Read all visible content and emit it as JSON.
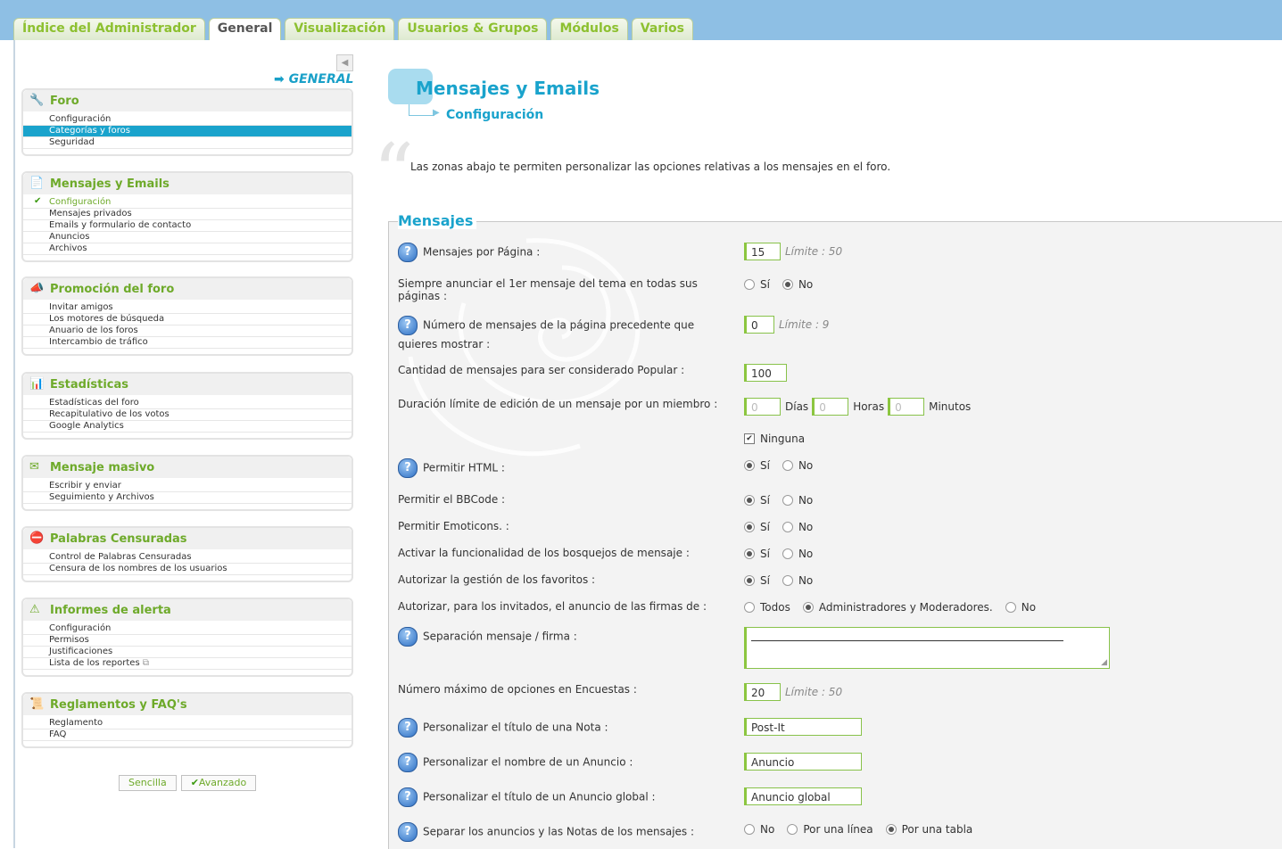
{
  "tabs": [
    "Índice del Administrador",
    "General",
    "Visualización",
    "Usuarios & Grupos",
    "Módulos",
    "Varios"
  ],
  "active_tab": "General",
  "breadcrumb": "➡ GENERAL",
  "sidebar": {
    "sections": [
      {
        "title": "Foro",
        "icon": "wrench-icon",
        "items": [
          "Configuración",
          "Categorías y foros",
          "Seguridad"
        ],
        "selected": 1
      },
      {
        "title": "Mensajes y Emails",
        "icon": "document-icon",
        "items": [
          "Configuración",
          "Mensajes privados",
          "Emails y formulario de contacto",
          "Anuncios",
          "Archivos"
        ],
        "current": 0
      },
      {
        "title": "Promoción del foro",
        "icon": "megaphone-icon",
        "items": [
          "Invitar amigos",
          "Los motores de búsqueda",
          "Anuario de los foros",
          "Intercambio de tráfico"
        ]
      },
      {
        "title": "Estadísticas",
        "icon": "chart-icon",
        "items": [
          "Estadísticas del foro",
          "Recapitulativo de los votos",
          "Google Analytics"
        ]
      },
      {
        "title": "Mensaje masivo",
        "icon": "mail-icon",
        "items": [
          "Escribir y enviar",
          "Seguimiento y Archivos"
        ]
      },
      {
        "title": "Palabras Censuradas",
        "icon": "forbidden-icon",
        "items": [
          "Control de Palabras Censuradas",
          "Censura de los nombres de los usuarios"
        ]
      },
      {
        "title": "Informes de alerta",
        "icon": "alert-icon",
        "items": [
          "Configuración",
          "Permisos",
          "Justificaciones",
          "Lista de los reportes"
        ]
      },
      {
        "title": "Reglamentos y FAQ's",
        "icon": "scroll-icon",
        "items": [
          "Reglamento",
          "FAQ"
        ]
      }
    ],
    "mode_simple": "Sencilla",
    "mode_advanced": "Avanzado"
  },
  "page": {
    "title": "Mensajes y Emails",
    "subtitle": "Configuración",
    "intro": "Las zonas abajo te permiten personalizar las opciones relativas a los mensajes en el foro.",
    "legend": "Mensajes"
  },
  "fields": {
    "posts_per_page": {
      "label": "Mensajes por Página :",
      "value": "15",
      "limit": "Límite : 50"
    },
    "announce_first": {
      "label": "Siempre anunciar el 1er mensaje del tema en todas sus páginas :",
      "yes": "Sí",
      "no": "No"
    },
    "prev_page_posts": {
      "label": "Número de mensajes de la página precedente que quieres mostrar :",
      "value": "0",
      "limit": "Límite : 9"
    },
    "popular_count": {
      "label": "Cantidad de mensajes para ser considerado Popular :",
      "value": "100"
    },
    "edit_limit": {
      "label": "Duración límite de edición de un mensaje por un miembro :",
      "days_ph": "0",
      "days": "Días",
      "hours_ph": "0",
      "hours": "Horas",
      "minutes_ph": "0",
      "minutes": "Minutos",
      "none": "Ninguna"
    },
    "allow_html": {
      "label": "Permitir HTML :",
      "yes": "Sí",
      "no": "No"
    },
    "allow_bbcode": {
      "label": "Permitir el BBCode :",
      "yes": "Sí",
      "no": "No"
    },
    "allow_emoticons": {
      "label": "Permitir Emoticons. :",
      "yes": "Sí",
      "no": "No"
    },
    "drafts": {
      "label": "Activar la funcionalidad de los bosquejos de mensaje :",
      "yes": "Sí",
      "no": "No"
    },
    "favorites": {
      "label": "Autorizar la gestión de los favoritos :",
      "yes": "Sí",
      "no": "No"
    },
    "guest_signatures": {
      "label": "Autorizar, para los invitados, el anuncio de las firmas de :",
      "opt1": "Todos",
      "opt2": "Administradores y Moderadores.",
      "opt3": "No"
    },
    "signature_sep": {
      "label": "Separación mensaje / firma :"
    },
    "poll_options": {
      "label": "Número máximo de opciones en Encuestas :",
      "value": "20",
      "limit": "Límite : 50"
    },
    "note_title": {
      "label": "Personalizar el título de una Nota :",
      "value": "Post-It"
    },
    "announce_name": {
      "label": "Personalizar el nombre de un Anuncio :",
      "value": "Anuncio"
    },
    "global_announce": {
      "label": "Personalizar el título de un Anuncio global :",
      "value": "Anuncio global"
    },
    "separate": {
      "label": "Separar los anuncios y las Notas de los mensajes :",
      "opt1": "No",
      "opt2": "Por una línea",
      "opt3": "Por una tabla"
    }
  },
  "colors": {
    "accent_blue": "#1aa3cc",
    "accent_green": "#6eaa2a",
    "topbar": "#8ebfe4"
  }
}
